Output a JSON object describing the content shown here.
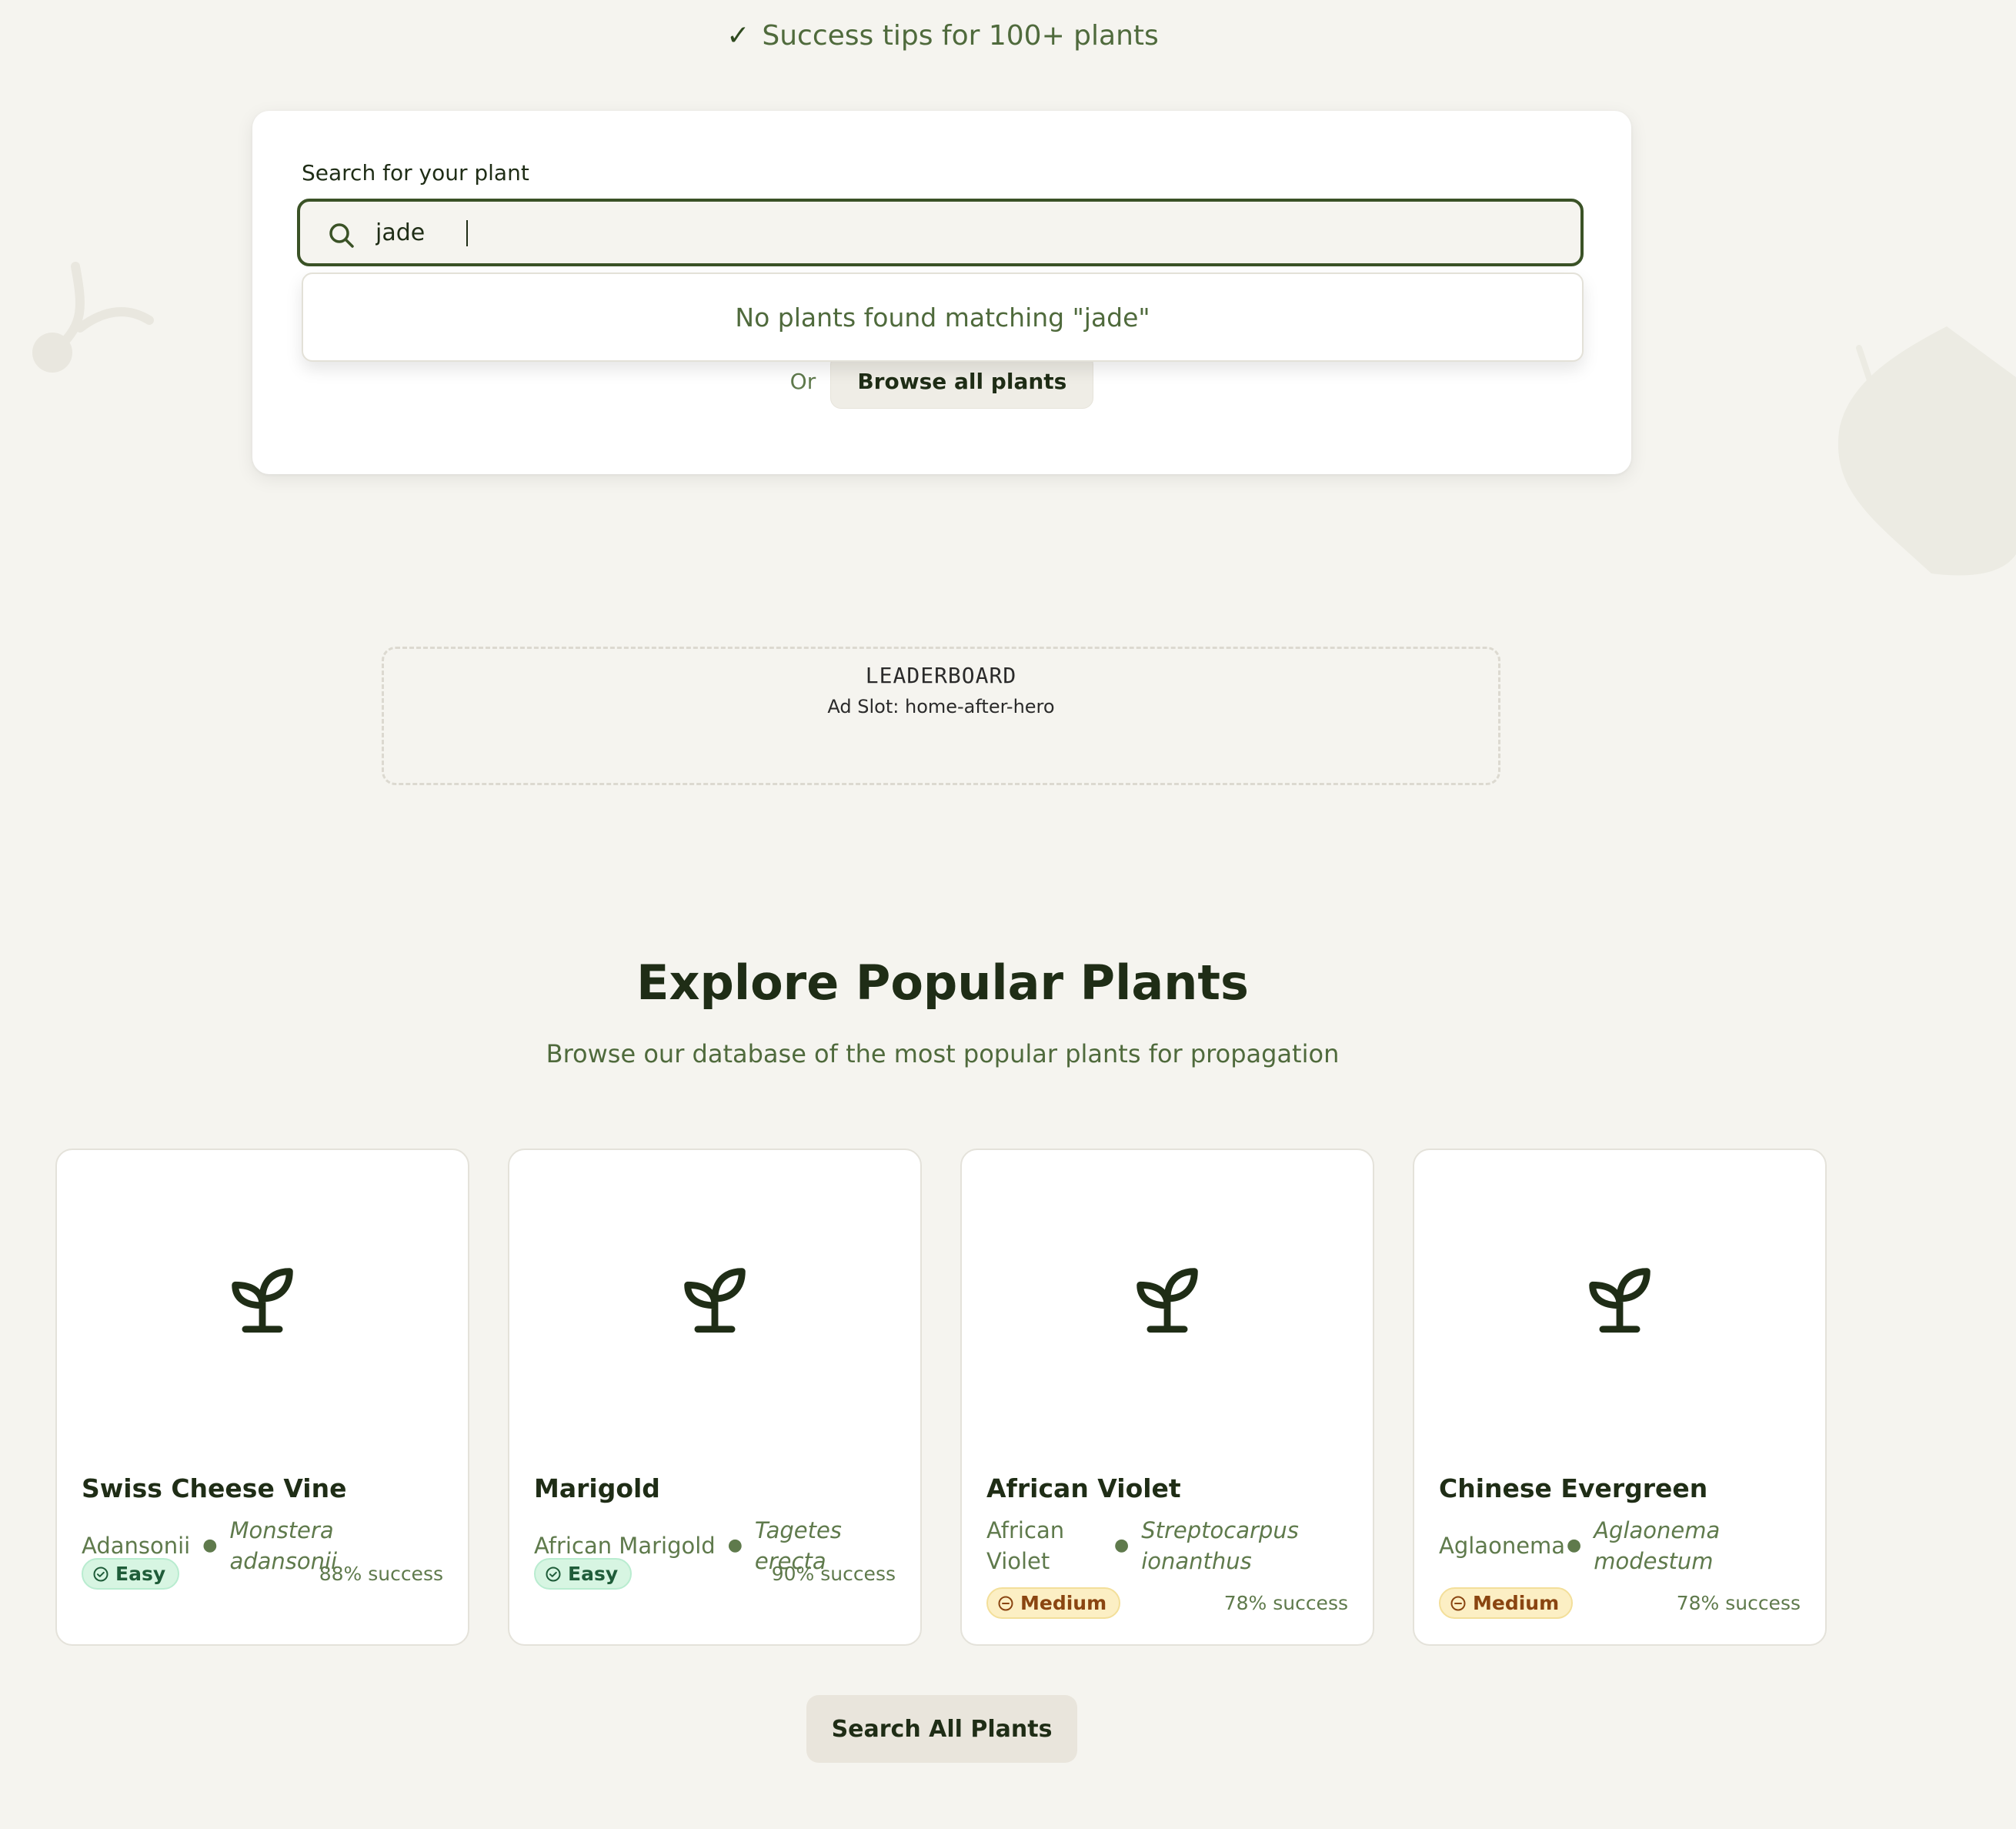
{
  "hero": {
    "check_glyph": "✓",
    "benefit": "Success tips for 100+ plants"
  },
  "search": {
    "label": "Search for your plant",
    "value": "jade",
    "no_results": "No plants found matching \"jade\"",
    "or_text": "Or",
    "browse_label": "Browse all plants"
  },
  "ad": {
    "title": "LEADERBOARD",
    "slot": "Ad Slot: home-after-hero"
  },
  "popular": {
    "title": "Explore Popular Plants",
    "subtitle": "Browse our database of the most popular plants for propagation",
    "cards": [
      {
        "name": "Swiss Cheese Vine",
        "common": "Adansonii",
        "scientific": "Monstera adansonii",
        "difficulty": "Easy",
        "success": "88% success"
      },
      {
        "name": "Marigold",
        "common": "African Marigold",
        "scientific": "Tagetes erecta",
        "difficulty": "Easy",
        "success": "90% success"
      },
      {
        "name": "African Violet",
        "common": "African Violet",
        "scientific": "Streptocarpus ionanthus",
        "difficulty": "Medium",
        "success": "78% success"
      },
      {
        "name": "Chinese Evergreen",
        "common": "Aglaonema",
        "scientific": "Aglaonema modestum",
        "difficulty": "Medium",
        "success": "78% success"
      }
    ],
    "search_all_label": "Search All Plants"
  },
  "colors": {
    "accent": "#3a5226",
    "easy_bg": "#d7f5e2",
    "medium_bg": "#fcefc4",
    "page_bg": "#f5f4ef"
  }
}
